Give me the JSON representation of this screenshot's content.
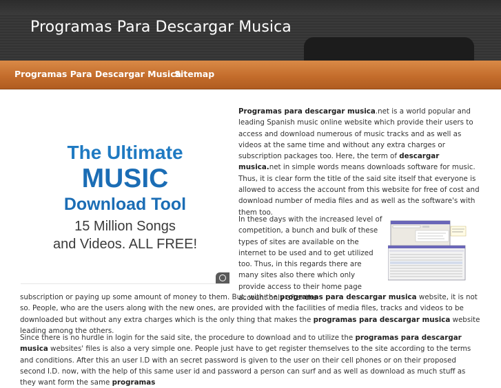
{
  "header": {
    "site_title": "Programas Para Descargar Musica"
  },
  "nav": {
    "items": [
      {
        "label": "Programas Para Descargar Musica"
      },
      {
        "label": "Sitemap"
      }
    ]
  },
  "ad": {
    "line1": "The Ultimate",
    "line2": "MUSIC",
    "line3": "Download Tool",
    "line4": "15 Million Songs",
    "line5": "and Videos. ALL FREE!",
    "info_icon": "info-icon"
  },
  "article": {
    "p1": {
      "b1": "Programas para descargar musica",
      "t1": ".net is a world popular and leading Spanish music online website which provide their users to access and download numerous of music tracks and as well as videos at the same time and without any extra charges or subscription packages too. Here, the term of ",
      "b2": "descargar musica.",
      "t2": "net in simple words means downloads software for music. Thus, it is clear form the title of the said site itself that everyone is allowed to access the account from this website for free of cost and download number of media files and as well as the software's with them too."
    },
    "p2": {
      "t1": "In these days with the increased level of competition, a bunch and bulk of these types of sites are available on the internet to be used and to get utilized too. Thus, in this regards there are many sites also there which only provide access to their home page account only after the"
    },
    "p3": {
      "t1": "subscription or paying up some amount of money to them. But, with the ",
      "b1": "programas para descargar musica",
      "t2": " website, it is not so. People, who are the users along with the new ones, are provided with the facilities of media files, tracks and videos to be downloaded but without any extra charges which is the only thing that makes the ",
      "b2": "programas para descargar musica",
      "t3": " website leading among the others."
    },
    "p4": {
      "t1": "Since there is no hurdle in login for the said site, the procedure to download and to utilize the ",
      "b1": "programas para descargar musica",
      "t2": " websites' files is also a very simple one. People just have to get register themselves to the site according to the terms and conditions. After this an user I.D with an secret password is given to the user on their cell phones or on their proposed second I.D. now, with the help of this same user id and password a person can surf and as well as download as much stuff as they want form the same ",
      "b2": "programas"
    }
  },
  "colors": {
    "header_bg": "#363636",
    "nav_bg": "#c46d2c",
    "ad_blue": "#1b6db5",
    "body_text": "#333333"
  }
}
